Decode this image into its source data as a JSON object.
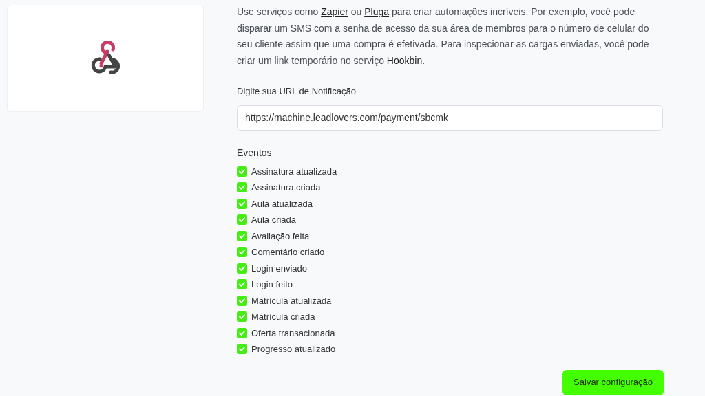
{
  "description": [
    {
      "kind": "text",
      "text": "Use serviços como "
    },
    {
      "kind": "link",
      "text": "Zapier"
    },
    {
      "kind": "text",
      "text": " ou "
    },
    {
      "kind": "link",
      "text": "Pluga"
    },
    {
      "kind": "text",
      "text": " para criar automações incríveis. Por exemplo, você pode disparar um SMS com a senha de acesso da sua área de membros para o número de celular do seu cliente assim que uma compra é efetivada. Para inspecionar as cargas enviadas, você pode criar um link temporário no serviço "
    },
    {
      "kind": "link",
      "text": "Hookbin"
    },
    {
      "kind": "text",
      "text": "."
    }
  ],
  "url_field": {
    "label": "Digite sua URL de Notificação",
    "value": "https://machine.leadlovers.com/payment/sbcmk"
  },
  "events": {
    "title": "Eventos",
    "items": [
      {
        "label": "Assinatura atualizada",
        "checked": true
      },
      {
        "label": "Assinatura criada",
        "checked": true
      },
      {
        "label": "Aula atualizada",
        "checked": true
      },
      {
        "label": "Aula criada",
        "checked": true
      },
      {
        "label": "Avaliação feita",
        "checked": true
      },
      {
        "label": "Comentário criado",
        "checked": true
      },
      {
        "label": "Login enviado",
        "checked": true
      },
      {
        "label": "Login feito",
        "checked": true
      },
      {
        "label": "Matrícula atualizada",
        "checked": true
      },
      {
        "label": "Matrícula criada",
        "checked": true
      },
      {
        "label": "Oferta transacionada",
        "checked": true
      },
      {
        "label": "Progresso atualizado",
        "checked": true
      }
    ]
  },
  "save_button": "Salvar configuração"
}
